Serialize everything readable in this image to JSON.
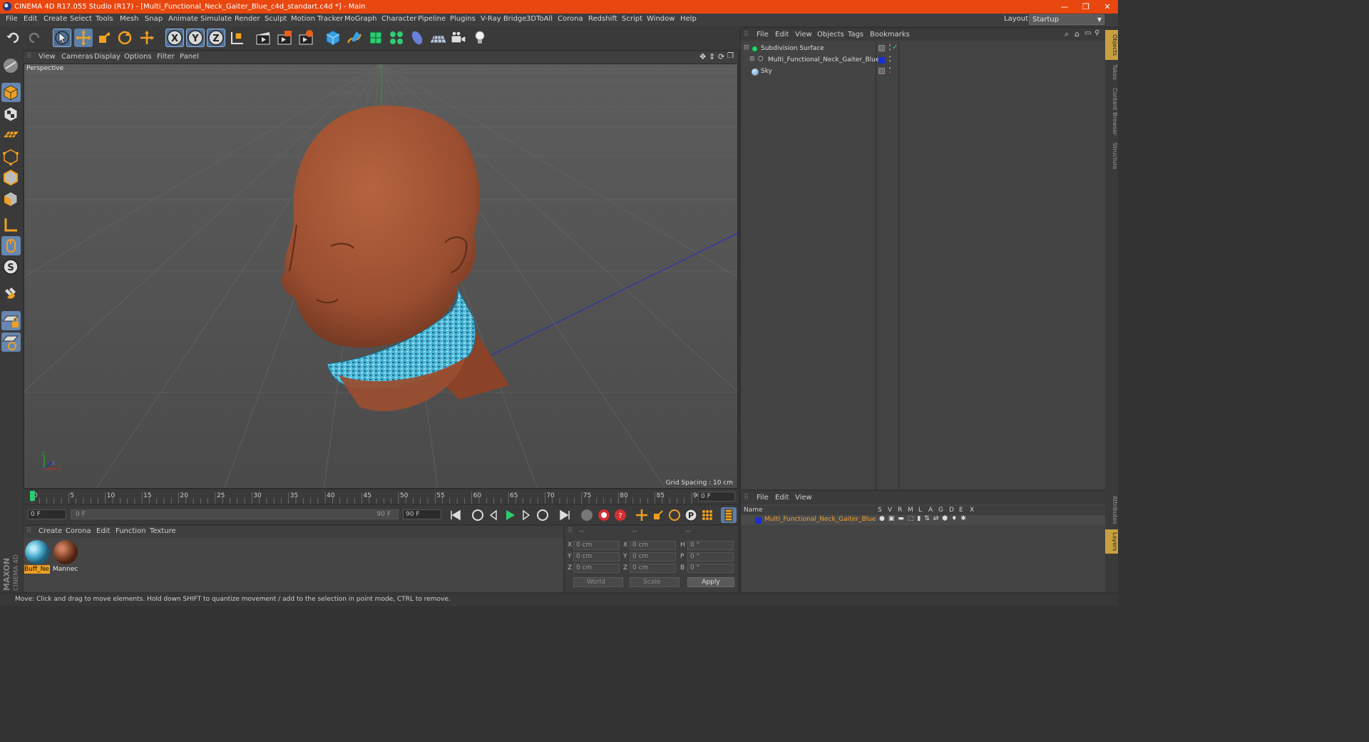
{
  "window": {
    "title": "CINEMA 4D R17.055 Studio (R17) - [Multi_Functional_Neck_Gaiter_Blue_c4d_standart.c4d *] - Main",
    "minimize": "—",
    "restore": "❐",
    "close": "✕"
  },
  "menubar": {
    "items": [
      "File",
      "Edit",
      "Create",
      "Select",
      "Tools",
      "Mesh",
      "Snap",
      "Animate",
      "Simulate",
      "Render",
      "Sculpt",
      "Motion Tracker",
      "MoGraph",
      "Character",
      "Pipeline",
      "Plugins",
      "V-Ray Bridge",
      "3DToAll",
      "Corona",
      "Redshift",
      "Script",
      "Window",
      "Help"
    ],
    "layout_label": "Layout:",
    "layout_value": "Startup"
  },
  "viewport": {
    "menu": [
      "View",
      "Cameras",
      "Display",
      "Options",
      "Filter",
      "Panel"
    ],
    "label": "Perspective",
    "grid_spacing": "Grid Spacing : 10 cm",
    "axis_x": "x",
    "axis_y": "y",
    "axis_z": "z"
  },
  "timeline": {
    "ticks": [
      "0",
      "5",
      "10",
      "15",
      "20",
      "25",
      "30",
      "35",
      "40",
      "45",
      "50",
      "55",
      "60",
      "65",
      "70",
      "75",
      "80",
      "85",
      "90"
    ],
    "current_frame": "0 F",
    "start_field": "0 F",
    "range_start": "0 F",
    "range_end": "90 F",
    "end_field": "90 F"
  },
  "materials": {
    "menu": [
      "Create",
      "Corona",
      "Edit",
      "Function",
      "Texture"
    ],
    "items": [
      {
        "label": "Buff_Ne",
        "color": "#4aa8c8",
        "selected": true
      },
      {
        "label": "Mannec",
        "color": "#8b4a30",
        "selected": false
      }
    ]
  },
  "coordinates": {
    "headers": [
      "--",
      "--",
      "--"
    ],
    "rows": [
      {
        "pos_label": "X",
        "pos": "0 cm",
        "size_label": "X",
        "size": "0 cm",
        "rot_label": "H",
        "rot": "0 °"
      },
      {
        "pos_label": "Y",
        "pos": "0 cm",
        "size_label": "Y",
        "size": "0 cm",
        "rot_label": "P",
        "rot": "0 °"
      },
      {
        "pos_label": "Z",
        "pos": "0 cm",
        "size_label": "Z",
        "size": "0 cm",
        "rot_label": "B",
        "rot": "0 °"
      }
    ],
    "mode": "World",
    "transform": "Scale",
    "apply": "Apply"
  },
  "objects": {
    "menu": [
      "File",
      "Edit",
      "View",
      "Objects",
      "Tags",
      "Bookmarks"
    ],
    "items": [
      {
        "name": "Subdivision Surface",
        "color": "#2ecc71"
      },
      {
        "name": "Multi_Functional_Neck_Gaiter_Blue",
        "color": "#1a2fd0"
      },
      {
        "name": "Sky",
        "color": "#6a9fd0"
      }
    ]
  },
  "layers": {
    "menu": [
      "File",
      "Edit",
      "View"
    ],
    "columns": [
      "Name",
      "S",
      "V",
      "R",
      "M",
      "L",
      "A",
      "G",
      "D",
      "E",
      "X"
    ],
    "row_name": "Multi_Functional_Neck_Gaiter_Blue",
    "row_color": "#1a2fd0"
  },
  "right_tabs": [
    "Objects",
    "Takes",
    "Content Browser",
    "Structure",
    "Attributes",
    "Layers"
  ],
  "status": "Move: Click and drag to move elements. Hold down SHIFT to quantize movement / add to the selection in point mode, CTRL to remove.",
  "brand": [
    "MAXON",
    "CINEMA 4D"
  ],
  "colors": {
    "accent": "#e8470f",
    "skin": "#a0553a",
    "gaiter": "#3ab0d0",
    "axis_y": "#2aa02a",
    "axis_x": "#2030c0"
  }
}
